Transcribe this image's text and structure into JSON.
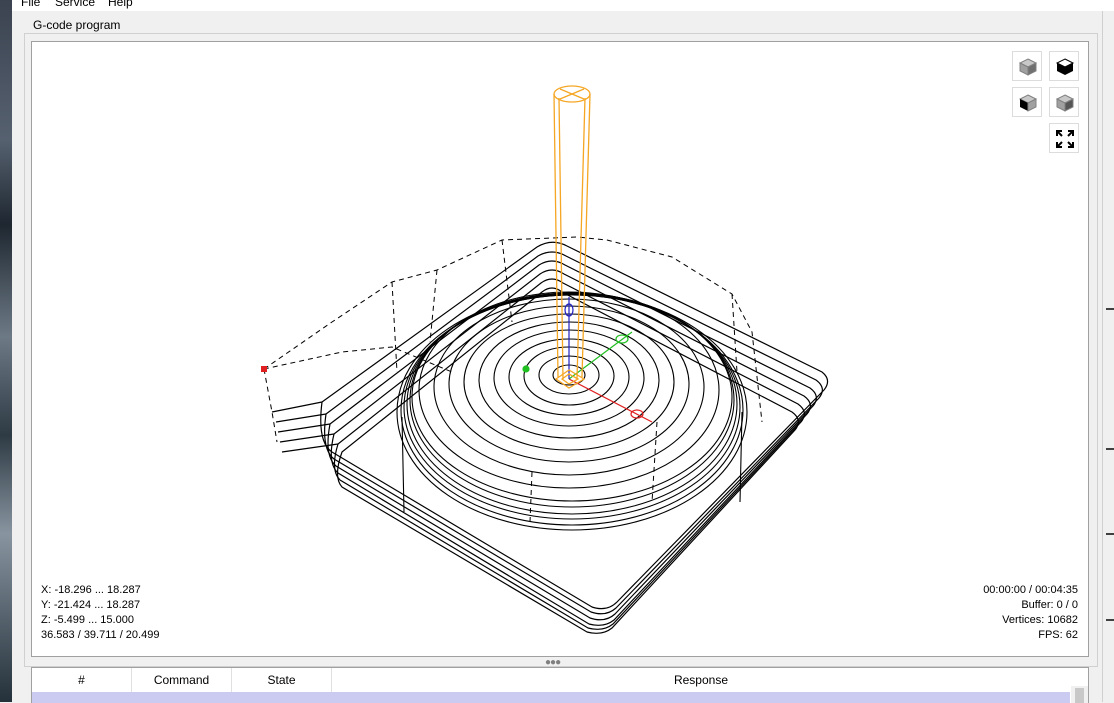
{
  "menu": {
    "file": "File",
    "service": "Service",
    "help": "Help"
  },
  "group_title": "G-code program",
  "viewport": {
    "buttons": [
      "isometric-view",
      "top-view",
      "front-view",
      "left-view",
      "fit-view"
    ],
    "bounds": {
      "x": "X: -18.296 ... 18.287",
      "y": "Y: -21.424 ... 18.287",
      "z": "Z: -5.499 ... 15.000",
      "size": "36.583 / 39.711 / 20.499"
    },
    "status": {
      "time": "00:00:00 / 00:04:35",
      "buffer": "Buffer: 0 / 0",
      "vertices": "Vertices: 10682",
      "fps": "FPS: 62"
    }
  },
  "table": {
    "columns": [
      "#",
      "Command",
      "State",
      "Response"
    ]
  },
  "colors": {
    "tool": "#f5a623",
    "axis_x": "#e02020",
    "axis_y": "#20c020",
    "axis_z": "#2020c0",
    "selected_row": "#cbcbf2"
  }
}
